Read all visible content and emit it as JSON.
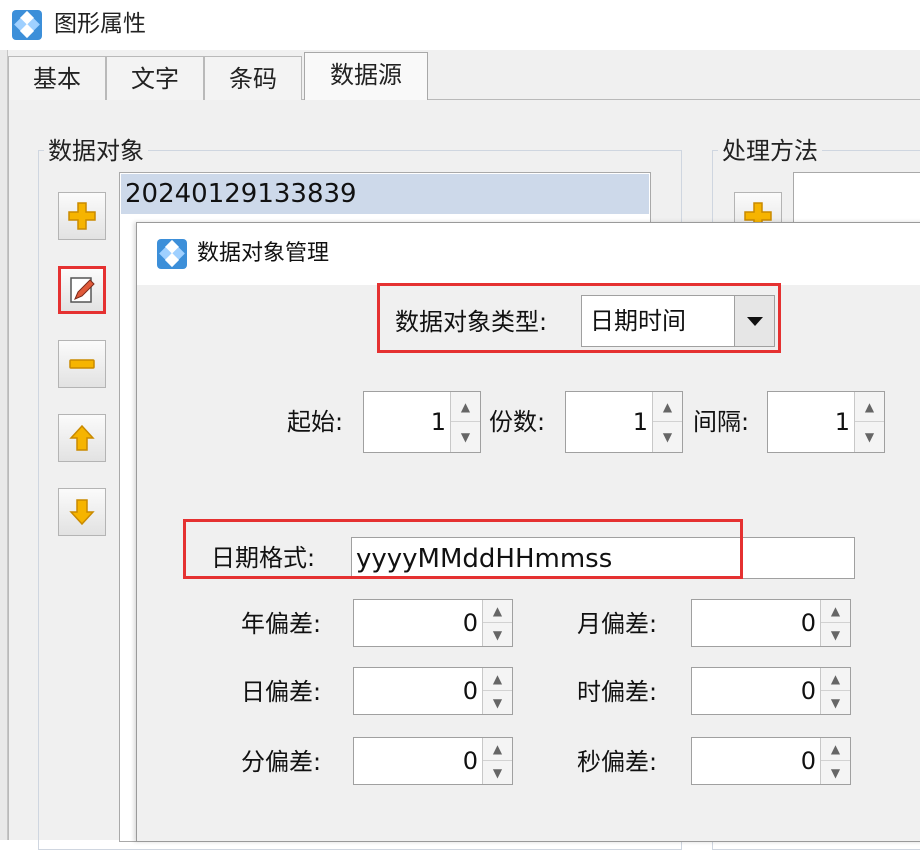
{
  "window": {
    "title": "图形属性"
  },
  "tabs": [
    {
      "label": "基本",
      "active": false
    },
    {
      "label": "文字",
      "active": false
    },
    {
      "label": "条码",
      "active": false
    },
    {
      "label": "数据源",
      "active": true
    }
  ],
  "data_objects": {
    "group_label": "数据对象",
    "items": [
      "20240129133839"
    ],
    "buttons": [
      "add-icon",
      "edit-icon",
      "remove-icon",
      "move-up-icon",
      "move-down-icon"
    ]
  },
  "processing": {
    "group_label": "处理方法",
    "buttons": [
      "add-icon"
    ]
  },
  "dialog": {
    "title": "数据对象管理",
    "type_label": "数据对象类型:",
    "type_value": "日期时间",
    "start_label": "起始:",
    "start_value": "1",
    "copies_label": "份数:",
    "copies_value": "1",
    "interval_label": "间隔:",
    "interval_value": "1",
    "format_label": "日期格式:",
    "format_value": "yyyyMMddHHmmss",
    "offsets": {
      "year_label": "年偏差:",
      "year_value": "0",
      "month_label": "月偏差:",
      "month_value": "0",
      "day_label": "日偏差:",
      "day_value": "0",
      "hour_label": "时偏差:",
      "hour_value": "0",
      "minute_label": "分偏差:",
      "minute_value": "0",
      "second_label": "秒偏差:",
      "second_value": "0"
    }
  },
  "colors": {
    "highlight": "#e53131",
    "selection": "#cdd9ea",
    "accent_yellow": "#f6b400"
  }
}
